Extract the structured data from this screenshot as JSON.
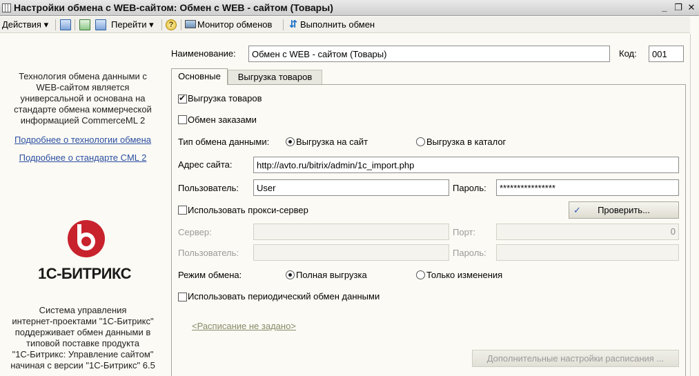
{
  "window": {
    "title": "Настройки обмена с WEB-сайтом: Обмен с WEB - сайтом (Товары)",
    "minimize": "_",
    "restore": "❐",
    "close": "✕"
  },
  "toolbar": {
    "actions_label": "Действия",
    "goto_label": "Перейти",
    "monitor_label": "Монитор обменов",
    "execute_label": "Выполнить обмен",
    "dropdown_arrow": "▾",
    "help_glyph": "?"
  },
  "left_panel": {
    "intro_lines": [
      "Технология обмена данными с",
      "WEB-сайтом является",
      "универсальной и основана на",
      "стандарте обмена коммерческой",
      "информацией CommerceML 2"
    ],
    "link_technology": "Подробнее о технологии обмена",
    "link_standard": "Подробнее о стандарте CML 2",
    "logo_text": "1С-БИТРИКС",
    "footer_lines": [
      "Система управления",
      "интернет-проектами \"1С-Битрикс\"",
      "поддерживает обмен данными в",
      "типовой поставке продукта",
      "\"1С-Битрикс: Управление сайтом\"",
      "начиная с версии \"1С-Битрикс\" 6.5"
    ]
  },
  "header": {
    "name_label": "Наименование:",
    "name_value": "Обмен с WEB - сайтом (Товары)",
    "code_label": "Код:",
    "code_value": "001"
  },
  "tabs": {
    "main": "Основные",
    "goods": "Выгрузка товаров"
  },
  "form": {
    "upload_goods_label": "Выгрузка товаров",
    "upload_goods_checked": true,
    "exchange_orders_label": "Обмен заказами",
    "exchange_orders_checked": false,
    "exchange_type_label": "Тип обмена данными:",
    "exchange_type_site": "Выгрузка на сайт",
    "exchange_type_catalog": "Выгрузка в каталог",
    "site_address_label": "Адрес сайта:",
    "site_address_value": "http://avto.ru/bitrix/admin/1c_import.php",
    "user_label": "Пользователь:",
    "user_value": "User",
    "password_label": "Пароль:",
    "password_value": "****************",
    "use_proxy_label": "Использовать прокси-сервер",
    "check_button": "Проверить...",
    "server_label": "Сервер:",
    "port_label": "Порт:",
    "port_value": "0",
    "proxy_user_label": "Пользователь:",
    "proxy_password_label": "Пароль:",
    "mode_label": "Режим обмена:",
    "mode_full": "Полная выгрузка",
    "mode_changes": "Только изменения",
    "periodic_label": "Использовать периодический обмен данными",
    "schedule_link": "<Расписание не задано>",
    "schedule_settings_button": "Дополнительные настройки расписания ..."
  }
}
